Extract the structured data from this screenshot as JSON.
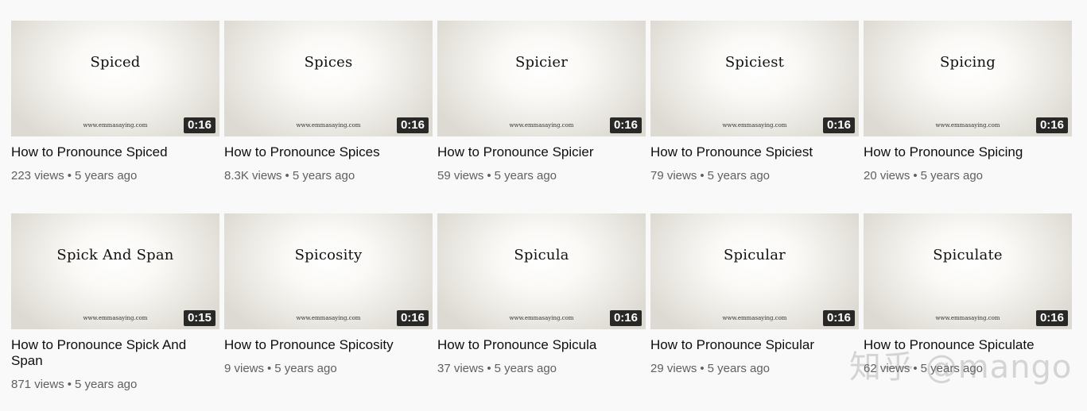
{
  "videos": [
    {
      "thumb_word": "Spiced",
      "site": "www.emmasaying.com",
      "duration": "0:16",
      "title": "How to Pronounce Spiced",
      "views": "223 views",
      "age": "5 years ago"
    },
    {
      "thumb_word": "Spices",
      "site": "www.emmasaying.com",
      "duration": "0:16",
      "title": "How to Pronounce Spices",
      "views": "8.3K views",
      "age": "5 years ago"
    },
    {
      "thumb_word": "Spicier",
      "site": "www.emmasaying.com",
      "duration": "0:16",
      "title": "How to Pronounce Spicier",
      "views": "59 views",
      "age": "5 years ago"
    },
    {
      "thumb_word": "Spiciest",
      "site": "www.emmasaying.com",
      "duration": "0:16",
      "title": "How to Pronounce Spiciest",
      "views": "79 views",
      "age": "5 years ago"
    },
    {
      "thumb_word": "Spicing",
      "site": "www.emmasaying.com",
      "duration": "0:16",
      "title": "How to Pronounce Spicing",
      "views": "20 views",
      "age": "5 years ago"
    },
    {
      "thumb_word": "Spick And Span",
      "site": "www.emmasaying.com",
      "duration": "0:15",
      "title": "How to Pronounce Spick And Span",
      "views": "871 views",
      "age": "5 years ago"
    },
    {
      "thumb_word": "Spicosity",
      "site": "www.emmasaying.com",
      "duration": "0:16",
      "title": "How to Pronounce Spicosity",
      "views": "9 views",
      "age": "5 years ago"
    },
    {
      "thumb_word": "Spicula",
      "site": "www.emmasaying.com",
      "duration": "0:16",
      "title": "How to Pronounce Spicula",
      "views": "37 views",
      "age": "5 years ago"
    },
    {
      "thumb_word": "Spicular",
      "site": "www.emmasaying.com",
      "duration": "0:16",
      "title": "How to Pronounce Spicular",
      "views": "29 views",
      "age": "5 years ago"
    },
    {
      "thumb_word": "Spiculate",
      "site": "www.emmasaying.com",
      "duration": "0:16",
      "title": "How to Pronounce Spiculate",
      "views": "62 views",
      "age": "5 years ago"
    }
  ],
  "meta_separator": "•",
  "watermark": "知乎 @mango"
}
